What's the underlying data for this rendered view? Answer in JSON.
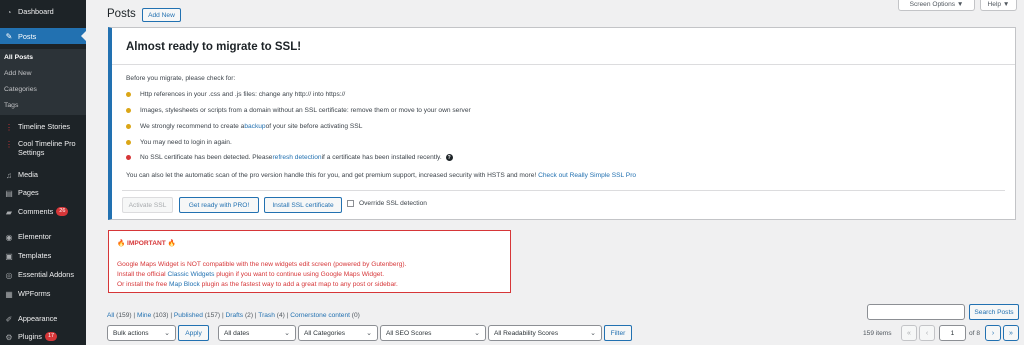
{
  "sidebar": {
    "dashboard": "Dashboard",
    "posts": "Posts",
    "submenu": [
      "All Posts",
      "Add New",
      "Categories",
      "Tags"
    ],
    "items": [
      {
        "label": "Timeline Stories",
        "icon": "timeline-icon"
      },
      {
        "label": "Cool Timeline Pro Settings",
        "icon": "timeline-settings-icon"
      },
      {
        "label": "Media",
        "icon": "media-icon"
      },
      {
        "label": "Pages",
        "icon": "pages-icon"
      },
      {
        "label": "Comments",
        "icon": "comments-icon",
        "badge": "26"
      },
      {
        "label": "Elementor",
        "icon": "elementor-icon"
      },
      {
        "label": "Templates",
        "icon": "templates-icon"
      },
      {
        "label": "Essential Addons",
        "icon": "essential-addons-icon"
      },
      {
        "label": "WPForms",
        "icon": "wpforms-icon"
      },
      {
        "label": "Appearance",
        "icon": "appearance-icon"
      },
      {
        "label": "Plugins",
        "icon": "plugins-icon",
        "badge": "17"
      }
    ]
  },
  "header": {
    "title": "Posts",
    "add_new": "Add New",
    "screen_options": "Screen Options ▼",
    "help": "Help ▼"
  },
  "ssl": {
    "title": "Almost ready to migrate to SSL!",
    "intro": "Before you migrate, please check for:",
    "item1": "Http references in your .css and .js files: change any http:// into https://",
    "item2": "Images, stylesheets or scripts from a domain without an SSL certificate: remove them or move to your own server",
    "item3_pre": "We strongly recommend to create a ",
    "item3_link": "backup",
    "item3_post": " of your site before activating SSL",
    "item4": "You may need to login in again.",
    "item5_pre": "No SSL certificate has been detected.  Please ",
    "item5_link": "refresh detection",
    "item5_post": " if a certificate has been installed recently.",
    "help_mark": "?",
    "footer_text": "You can also let the automatic scan of the pro version handle this for you, and get premium support, increased security with HSTS and more! ",
    "footer_link": "Check out Really Simple SSL Pro",
    "btn_activate": "Activate SSL",
    "btn_pro": "Get ready with PRO!",
    "btn_install": "Install SSL certificate",
    "override_label": "Override SSL detection"
  },
  "notice": {
    "title": "🔥 IMPORTANT 🔥",
    "line1": "Google Maps Widget is NOT compatible with the new widgets edit screen (powered by Gutenberg).",
    "line2_pre": "Install the official ",
    "line2_link": "Classic Widgets",
    "line2_post": " plugin if you want to continue using Google Maps Widget.",
    "line3_pre": "Or install the free ",
    "line3_link": "Map Block",
    "line3_post": " plugin as the fastest way to add a great map to any post or sidebar."
  },
  "views": [
    {
      "label": "All",
      "count": "(159)"
    },
    {
      "label": "Mine",
      "count": "(103)"
    },
    {
      "label": "Published",
      "count": "(157)"
    },
    {
      "label": "Drafts",
      "count": "(2)"
    },
    {
      "label": "Trash",
      "count": "(4)"
    },
    {
      "label": "Cornerstone content",
      "count": "(0)"
    }
  ],
  "search": {
    "button": "Search Posts",
    "value": ""
  },
  "filters": {
    "bulk": "Bulk actions",
    "apply": "Apply",
    "dates": "All dates",
    "categories": "All Categories",
    "seo": "All SEO Scores",
    "readability": "All Readability Scores",
    "filter": "Filter"
  },
  "pagination": {
    "items": "159 items",
    "first": "«",
    "prev": "‹",
    "current": "1",
    "of": "of 8",
    "next": "›",
    "last": "»"
  },
  "colors": {
    "sidebar_bg": "#1d2327",
    "accent": "#2271b1",
    "dot_warning": "#dba617",
    "dot_error": "#d63638",
    "notice_red": "#d63638"
  }
}
